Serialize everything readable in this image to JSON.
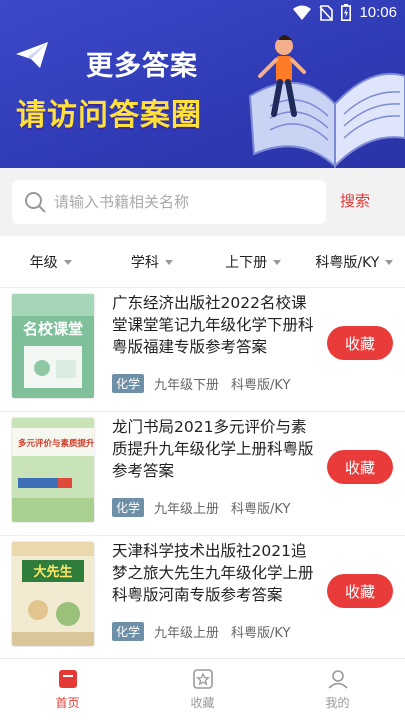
{
  "status_bar": {
    "time": "10:06"
  },
  "banner": {
    "line1": "更多答案",
    "line2": "请访问答案圈"
  },
  "search": {
    "placeholder": "请输入书籍相关名称",
    "button_label": "搜索"
  },
  "filters": [
    {
      "label": "年级"
    },
    {
      "label": "学科"
    },
    {
      "label": "上下册"
    },
    {
      "label": "科粤版/KY"
    }
  ],
  "books": [
    {
      "title": "广东经济出版社2022名校课堂课堂笔记九年级化学下册科粤版福建专版参考答案",
      "subject": "化学",
      "grade": "九年级下册",
      "edition": "科粤版/KY",
      "collect_label": "收藏",
      "cover_text": "名校课堂"
    },
    {
      "title": "龙门书局2021多元评价与素质提升九年级化学上册科粤版参考答案",
      "subject": "化学",
      "grade": "九年级上册",
      "edition": "科粤版/KY",
      "collect_label": "收藏",
      "cover_text": "多元评价与素质提升"
    },
    {
      "title": "天津科学技术出版社2021追梦之旅大先生九年级化学上册科粤版河南专版参考答案",
      "subject": "化学",
      "grade": "九年级上册",
      "edition": "科粤版/KY",
      "collect_label": "收藏",
      "cover_text": "大先生"
    }
  ],
  "tabs": [
    {
      "label": "首页",
      "icon": "home-icon",
      "active": true
    },
    {
      "label": "收藏",
      "icon": "star-icon",
      "active": false
    },
    {
      "label": "我的",
      "icon": "user-icon",
      "active": false
    }
  ],
  "colors": {
    "accent": "#e53935",
    "banner": "#3d49c9",
    "banner_yellow": "#ffe13a",
    "tag": "#6d8fa8"
  }
}
